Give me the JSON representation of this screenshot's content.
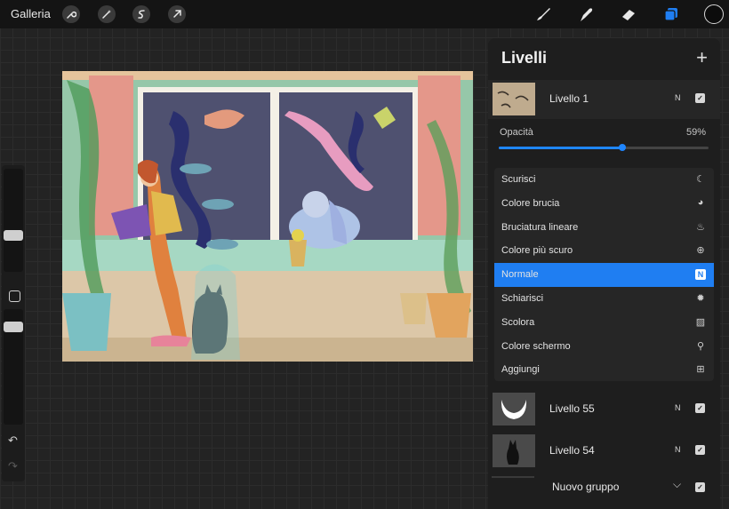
{
  "topbar": {
    "gallery_label": "Galleria",
    "left_icons": [
      "wrench-icon",
      "magic-wand-icon",
      "selection-s-icon",
      "arrow-transform-icon"
    ],
    "tools": [
      "brush-icon",
      "smudge-icon",
      "eraser-icon",
      "layers-icon"
    ],
    "current_color": "#0c0c0c",
    "accent_color": "#1f7ef2"
  },
  "sidebar": {
    "undo_icon": "undo-icon",
    "redo_icon": "redo-icon"
  },
  "layers_panel": {
    "title": "Livelli",
    "add_icon": "plus-icon",
    "top_layer": {
      "name": "Livello 1",
      "blend_badge": "N",
      "visible": true
    },
    "opacity_label": "Opacità",
    "opacity_value": "59%",
    "opacity_fraction": 0.59,
    "blend_modes": [
      {
        "label": "Scurisci",
        "icon": "moon-icon",
        "glyph": "☾",
        "active": false
      },
      {
        "label": "Colore brucia",
        "icon": "burn-icon",
        "glyph": "◕",
        "active": false
      },
      {
        "label": "Bruciatura lineare",
        "icon": "flame-icon",
        "glyph": "♨",
        "active": false
      },
      {
        "label": "Colore più scuro",
        "icon": "plus-circle-icon",
        "glyph": "⊕",
        "active": false
      },
      {
        "label": "Normale",
        "icon": "normal-n-icon",
        "glyph": "N",
        "active": true
      },
      {
        "label": "Schiarisci",
        "icon": "sun-icon",
        "glyph": "✹",
        "active": false
      },
      {
        "label": "Scolora",
        "icon": "hatch-icon",
        "glyph": "▨",
        "active": false
      },
      {
        "label": "Colore schermo",
        "icon": "search-icon",
        "glyph": "⚲",
        "active": false
      },
      {
        "label": "Aggiungi",
        "icon": "add-square-icon",
        "glyph": "⊞",
        "active": false
      }
    ],
    "lower_layers": [
      {
        "name": "Livello 55",
        "blend_badge": "N",
        "visible": true
      },
      {
        "name": "Livello 54",
        "blend_badge": "N",
        "visible": true
      }
    ],
    "group": {
      "name": "Nuovo gruppo",
      "visible": true
    }
  }
}
